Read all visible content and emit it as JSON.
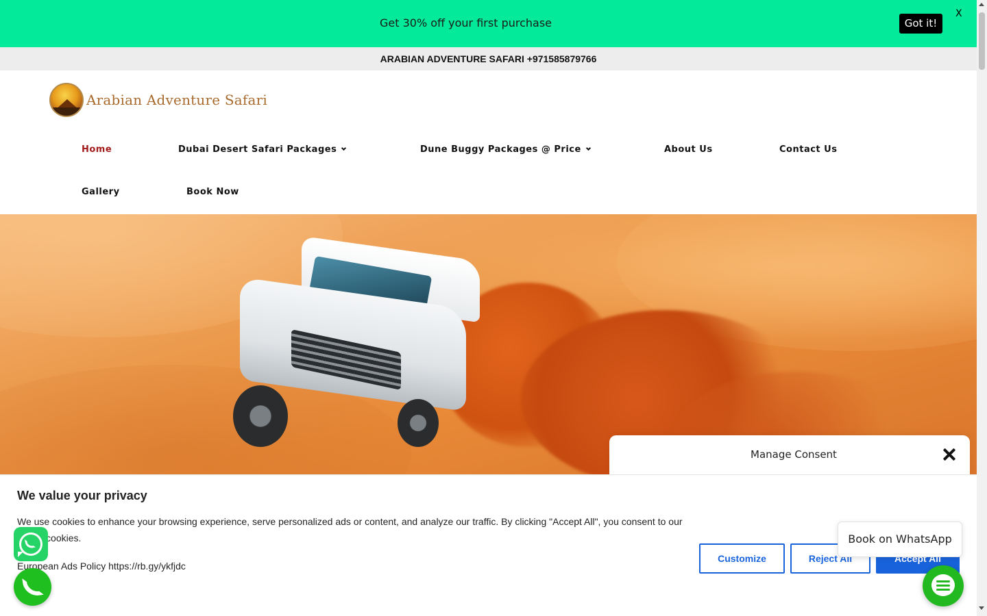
{
  "promo": {
    "text": "Get 30% off your first purchase",
    "got_it_label": "Got it!",
    "close_label": "X"
  },
  "contact_bar": {
    "text": "ARABIAN ADVENTURE SAFARI  +971585879766"
  },
  "logo": {
    "text": "Arabian Adventure Safari"
  },
  "nav": {
    "items": [
      {
        "label": "Home",
        "active": true
      },
      {
        "label": "Dubai Desert Safari Packages",
        "dropdown": true
      },
      {
        "label": "Dune Buggy Packages @ Price",
        "dropdown": true
      },
      {
        "label": "About Us"
      },
      {
        "label": "Contact Us"
      },
      {
        "label": "Gallery"
      },
      {
        "label": "Book Now"
      }
    ]
  },
  "consent": {
    "title": "Manage Consent"
  },
  "cookie": {
    "title": "We value your privacy",
    "description": "We use cookies to enhance your browsing experience, serve personalized ads or content, and analyze our traffic. By clicking \"Accept All\", you consent to our use of cookies.",
    "policy": "European Ads Policy https://rb.gy/ykfjdc",
    "customize_label": "Customize",
    "reject_label": "Reject All",
    "accept_label": "Accept All"
  },
  "whatsapp": {
    "book_label": "Book on WhatsApp"
  },
  "colors": {
    "promo_bg": "#03ea9b",
    "nav_active": "#a41b1b",
    "primary_blue": "#1863dc",
    "whatsapp_green": "#25d366"
  }
}
